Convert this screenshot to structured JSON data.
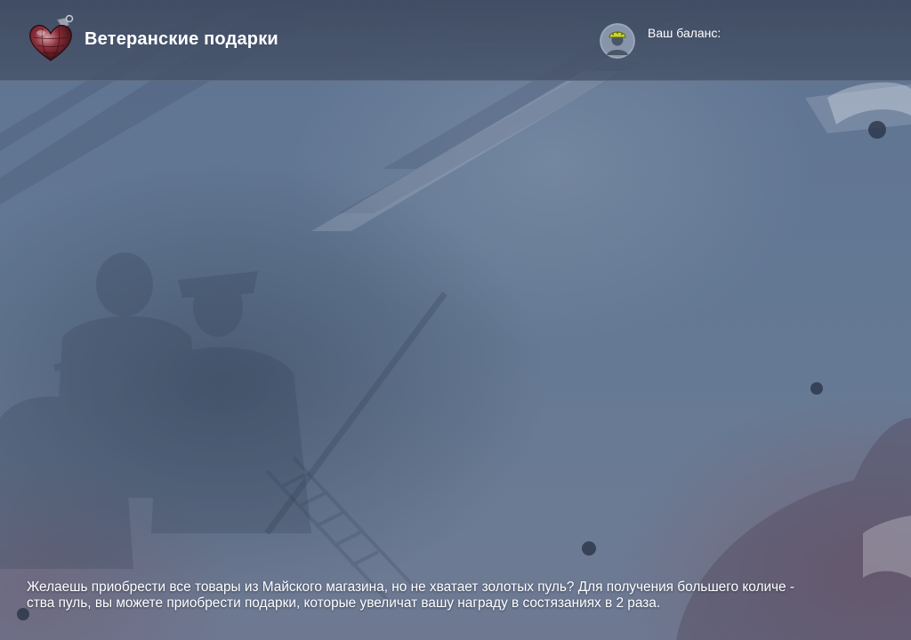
{
  "header": {
    "title": "Ветеранские подарки",
    "logo_icon": "grenade-heart-icon",
    "balance_label": "Ваш баланс:",
    "avatar_icon": "soldier-avatar-icon"
  },
  "background": {
    "image": "ww2-soldiers-ribbon-illustration"
  },
  "content": {
    "description_line1": "Желаешь приобрести все товары из Майского магазина, но не хватает золотых пуль? Для получения большего количе -",
    "description_line2": "ства пуль, вы можете приобрести подарки, которые увеличат вашу награду в состязаниях в 2 раза."
  },
  "colors": {
    "background": "#637893",
    "header": "#3e4a60",
    "text": "#ffffff",
    "grenade": "#8c2f3a"
  }
}
